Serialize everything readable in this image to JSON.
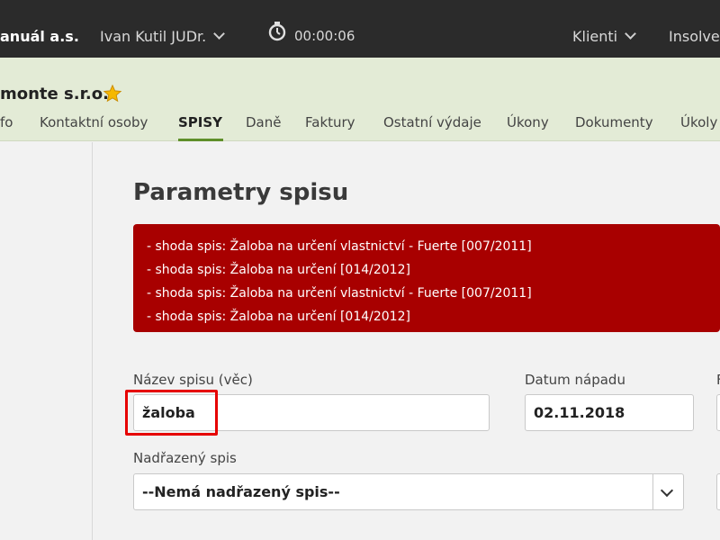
{
  "topbar": {
    "firm": "anuál a.s.",
    "user": "Ivan Kutil JUDr.",
    "timer": "00:00:06",
    "clients": "Klienti",
    "insolvence": "Insolve"
  },
  "client": {
    "name": "monte s.r.o."
  },
  "tabs": [
    {
      "label": "fo"
    },
    {
      "label": "Kontaktní osoby"
    },
    {
      "label": "SPISY"
    },
    {
      "label": "Daně"
    },
    {
      "label": "Faktury"
    },
    {
      "label": "Ostatní výdaje"
    },
    {
      "label": "Úkony"
    },
    {
      "label": "Dokumenty"
    },
    {
      "label": "Úkoly"
    }
  ],
  "main": {
    "title": "Parametry spisu",
    "alerts": [
      "- shoda spis: Žaloba na určení vlastnictví - Fuerte [007/2011]",
      "- shoda spis: Žaloba na určení [014/2012]",
      "- shoda spis: Žaloba na určení vlastnictví - Fuerte [007/2011]",
      "- shoda spis: Žaloba na určení [014/2012]"
    ],
    "name_label": "Název spisu (věc)",
    "name_value": "žaloba",
    "date_label": "Datum nápadu",
    "date_value": "02.11.2018",
    "next_label_fragment": "F",
    "parent_label": "Nadřazený spis",
    "parent_value": "--Nemá nadřazený spis--"
  },
  "colors": {
    "topbar": "#2b2b2b",
    "client_header": "#e3ebd6",
    "alert": "#a80000",
    "accent": "#5f8f2a",
    "highlight": "#e60000"
  }
}
